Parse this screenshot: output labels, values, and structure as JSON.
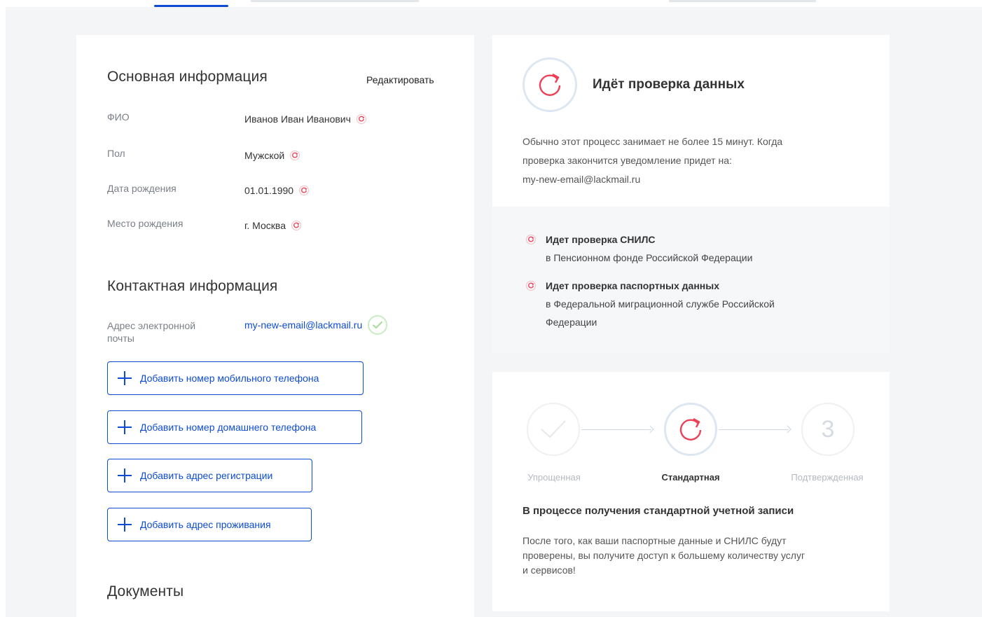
{
  "basic_info": {
    "title": "Основная информация",
    "edit_label": "Редактировать",
    "fields": [
      {
        "label": "ФИО",
        "value": "Иванов Иван Иванович"
      },
      {
        "label": "Пол",
        "value": "Мужской"
      },
      {
        "label": "Дата рождения",
        "value": "01.01.1990"
      },
      {
        "label": "Место рождения",
        "value": "г. Москва"
      }
    ]
  },
  "contact_info": {
    "title": "Контактная информация",
    "email_label": "Адрес электронной почты",
    "email_value": "my-new-email@lackmail.ru",
    "buttons": [
      "Добавить номер мобильного телефона",
      "Добавить номер домашнего телефона",
      "Добавить адрес регистрации",
      "Добавить адрес проживания"
    ]
  },
  "documents": {
    "title": "Документы"
  },
  "status": {
    "title": "Идёт проверка данных",
    "desc_line1": "Обычно этот процесс занимает не более 15 минут. Когда",
    "desc_line2": "проверка закончится уведомление придет на:",
    "desc_email": "my-new-email@lackmail.ru",
    "checks": [
      {
        "title": "Идет проверка СНИЛС",
        "detail1": "в Пенсионном фонде Российской Федерации",
        "detail2": ""
      },
      {
        "title": "Идет проверка паспортных данных",
        "detail1": "в Федеральной миграционной службе Российской",
        "detail2": "Федерации"
      }
    ]
  },
  "level": {
    "steps": [
      {
        "label": "Упрощенная",
        "state": "done"
      },
      {
        "label": "Стандартная",
        "state": "active"
      },
      {
        "label": "Подтвержденная",
        "state": "pending",
        "number": "3"
      }
    ],
    "title": "В процессе получения стандартной учетной записи",
    "desc_line1": "После того, как ваши паспортные данные и СНИЛС будут",
    "desc_line2": "проверены, вы получите доступ к большему количеству услуг",
    "desc_line3": "и сервисов!"
  },
  "colors": {
    "accent": "#0d4cd3",
    "pending": "#ee3f58",
    "success": "#a5dc98",
    "background": "#f3f5f7"
  }
}
